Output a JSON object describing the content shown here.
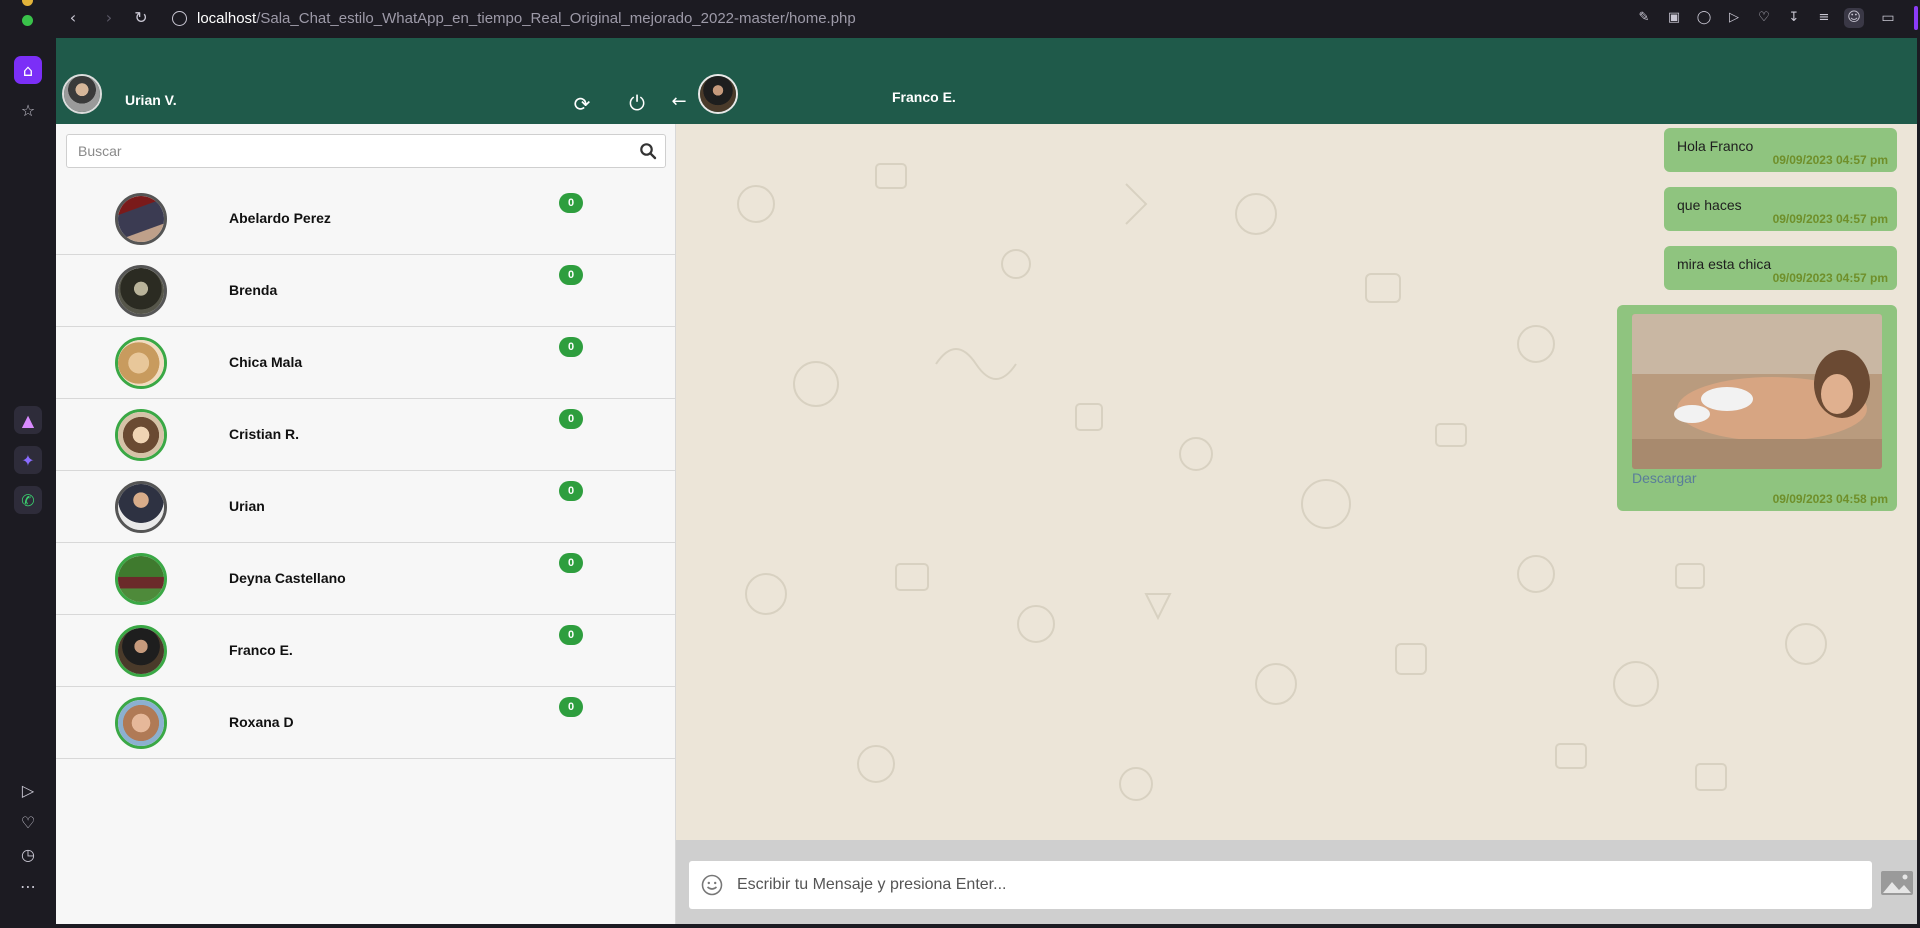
{
  "browser": {
    "url_host": "localhost",
    "url_path": "/Sala_Chat_estilo_WhatApp_en_tiempo_Real_Original_mejorado_2022-master/home.php",
    "accent_color": "#7b2ff7"
  },
  "header": {
    "user_name": "Urian V.",
    "chat_contact_name": "Franco E.",
    "color": "#1f5a4a"
  },
  "search": {
    "placeholder": "Buscar"
  },
  "contacts": [
    {
      "name": "Abelardo Perez",
      "unread": "0"
    },
    {
      "name": "Brenda",
      "unread": "0"
    },
    {
      "name": "Chica Mala",
      "unread": "0"
    },
    {
      "name": "Cristian R.",
      "unread": "0"
    },
    {
      "name": "Urian",
      "unread": "0"
    },
    {
      "name": "Deyna Castellano",
      "unread": "0"
    },
    {
      "name": "Franco E.",
      "unread": "0"
    },
    {
      "name": "Roxana D",
      "unread": "0"
    }
  ],
  "messages": [
    {
      "text": "Hola Franco",
      "time": "09/09/2023 04:57 pm"
    },
    {
      "text": "que haces",
      "time": "09/09/2023 04:57 pm"
    },
    {
      "text": "mira esta chica",
      "time": "09/09/2023 04:57 pm"
    },
    {
      "download_label": "Descargar",
      "time": "09/09/2023 04:58 pm"
    }
  ],
  "compose": {
    "placeholder": "Escribir tu Mensaje y presiona Enter..."
  }
}
